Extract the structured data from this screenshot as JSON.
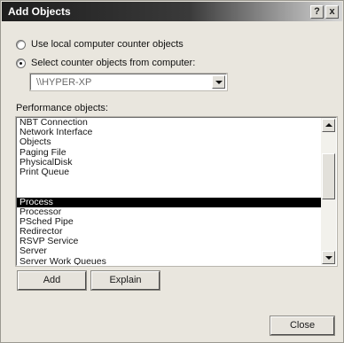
{
  "window": {
    "title": "Add Objects",
    "help_button": "?",
    "close_button": "x"
  },
  "source": {
    "option_local": "Use local computer counter objects",
    "option_remote": "Select counter objects from computer:",
    "selected": "remote",
    "computer_value": "\\\\HYPER-XP"
  },
  "performance_objects": {
    "label": "Performance objects:",
    "selected_index": 8,
    "items": [
      "NBT Connection",
      "Network Interface",
      "Objects",
      "Paging File",
      "PhysicalDisk",
      "Print Queue",
      "",
      "",
      "Process",
      "Processor",
      "PSched Pipe",
      "Redirector",
      "RSVP Service",
      "Server",
      "Server Work Queues"
    ]
  },
  "buttons": {
    "add": "Add",
    "explain": "Explain",
    "close": "Close"
  }
}
